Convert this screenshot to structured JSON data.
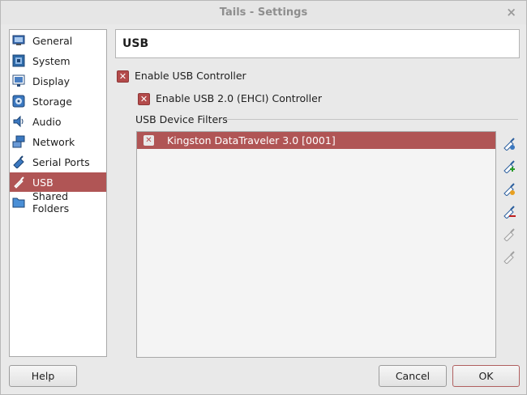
{
  "window": {
    "title": "Tails - Settings",
    "close_glyph": "×"
  },
  "sidebar": {
    "items": [
      {
        "label": "General",
        "icon": "general-icon"
      },
      {
        "label": "System",
        "icon": "system-icon"
      },
      {
        "label": "Display",
        "icon": "display-icon"
      },
      {
        "label": "Storage",
        "icon": "storage-icon"
      },
      {
        "label": "Audio",
        "icon": "audio-icon"
      },
      {
        "label": "Network",
        "icon": "network-icon"
      },
      {
        "label": "Serial Ports",
        "icon": "serial-ports-icon"
      },
      {
        "label": "USB",
        "icon": "usb-icon",
        "selected": true
      },
      {
        "label": "Shared Folders",
        "icon": "shared-folders-icon"
      }
    ]
  },
  "page": {
    "title": "USB"
  },
  "usb": {
    "enable_controller_label": "Enable USB Controller",
    "enable_controller_checked": true,
    "enable_ehci_label": "Enable USB 2.0 (EHCI) Controller",
    "enable_ehci_checked": true,
    "filters_label": "USB Device Filters",
    "filters": [
      {
        "name": "Kingston DataTraveler 3.0 [0001]",
        "checked": true
      }
    ]
  },
  "toolbar_icons": [
    "add-empty-filter-icon",
    "add-filter-from-device-icon",
    "edit-filter-icon",
    "remove-filter-icon",
    "move-filter-up-icon",
    "move-filter-down-icon"
  ],
  "buttons": {
    "help": "Help",
    "cancel": "Cancel",
    "ok": "OK"
  },
  "colors": {
    "selection": "#b05555",
    "checkbox": "#b34a4a"
  }
}
